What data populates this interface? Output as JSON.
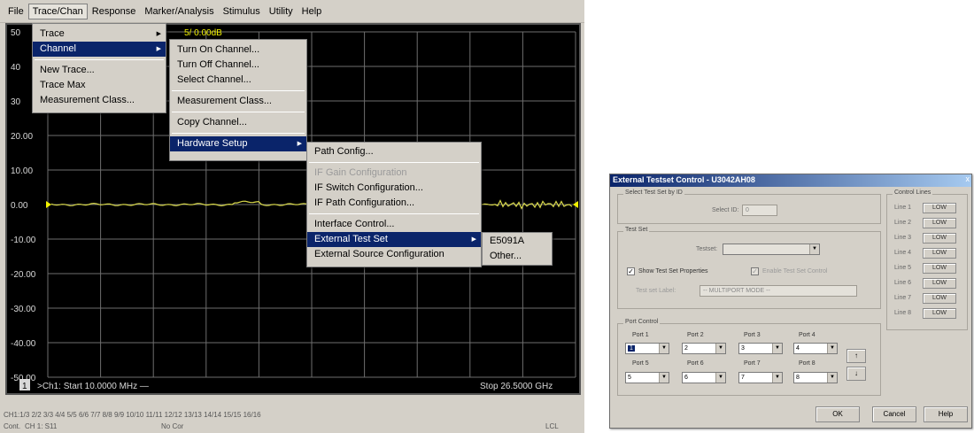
{
  "menubar": {
    "items": [
      "File",
      "Trace/Chan",
      "Response",
      "Marker/Analysis",
      "Stimulus",
      "Utility",
      "Help"
    ]
  },
  "trace_menu": {
    "items": [
      "Trace",
      "Channel",
      "New Trace...",
      "Trace Max",
      "Measurement Class..."
    ]
  },
  "channel_menu": {
    "items": [
      "Turn On Channel...",
      "Turn Off Channel...",
      "Select Channel...",
      "Measurement Class...",
      "Copy Channel...",
      "Hardware Setup"
    ]
  },
  "hardware_menu": {
    "items": [
      "Path Config...",
      "IF Gain Configuration",
      "IF Switch Configuration...",
      "IF Path Configuration...",
      "Interface Control...",
      "External Test Set",
      "External Source Configuration"
    ]
  },
  "testset_menu": {
    "items": [
      "E5091A",
      "Other..."
    ]
  },
  "plot": {
    "scale_header": "5/ 0.00dB",
    "y_ticks": [
      "50",
      "40",
      "30",
      "20.00",
      "10.00",
      "0.00",
      "-10.00",
      "-20.00",
      "-30.00",
      "-40.00",
      "-50.00"
    ],
    "footer_channel_num": "1",
    "footer_start": ">Ch1: Start  10.0000 MHz —",
    "footer_stop": "Stop  26.5000 GHz",
    "colors": {
      "trace": "#d9d94a",
      "grid": "#6e6e6e",
      "text": "#d8d8d8",
      "marker": "#f2f200"
    }
  },
  "status": {
    "line1": "CH1:1/3 2/2 3/3 4/4 5/5 6/6 7/7 8/8 9/9 10/10 11/11 12/12 13/13 14/14 15/15 16/16",
    "cont": "Cont.",
    "meas": "CH 1:  S11",
    "cor": "No Cor",
    "lcl": "LCL"
  },
  "dialog": {
    "title": "External Testset Control - U3042AH08",
    "close_glyph": "x",
    "select_group": "Select Test Set by ID",
    "select_id_label": "Select ID:",
    "select_id_value": "0",
    "testset_group": "Test Set",
    "testset_label": "Testset:",
    "show_props_label": "Show Test Set Properties",
    "enable_label": "Enable Test Set Control",
    "label_label": "Test set Label:",
    "label_value": "-- MULTIPORT MODE --",
    "port_group": "Port Control",
    "ports": [
      {
        "label": "Port 1",
        "value": "1",
        "selected": true
      },
      {
        "label": "Port 2",
        "value": "2"
      },
      {
        "label": "Port 3",
        "value": "3"
      },
      {
        "label": "Port 4",
        "value": "4"
      },
      {
        "label": "Port 5",
        "value": "5"
      },
      {
        "label": "Port 6",
        "value": "6"
      },
      {
        "label": "Port 7",
        "value": "7"
      },
      {
        "label": "Port 8",
        "value": "8"
      }
    ],
    "up_glyph": "↑",
    "down_glyph": "↓",
    "control_group": "Control Lines",
    "lines": [
      {
        "label": "Line 1",
        "value": "LOW"
      },
      {
        "label": "Line 2",
        "value": "LOW"
      },
      {
        "label": "Line 3",
        "value": "LOW"
      },
      {
        "label": "Line 4",
        "value": "LOW"
      },
      {
        "label": "Line 5",
        "value": "LOW"
      },
      {
        "label": "Line 6",
        "value": "LOW"
      },
      {
        "label": "Line 7",
        "value": "LOW"
      },
      {
        "label": "Line 8",
        "value": "LOW"
      }
    ],
    "ok": "OK",
    "cancel": "Cancel",
    "help": "Help"
  }
}
